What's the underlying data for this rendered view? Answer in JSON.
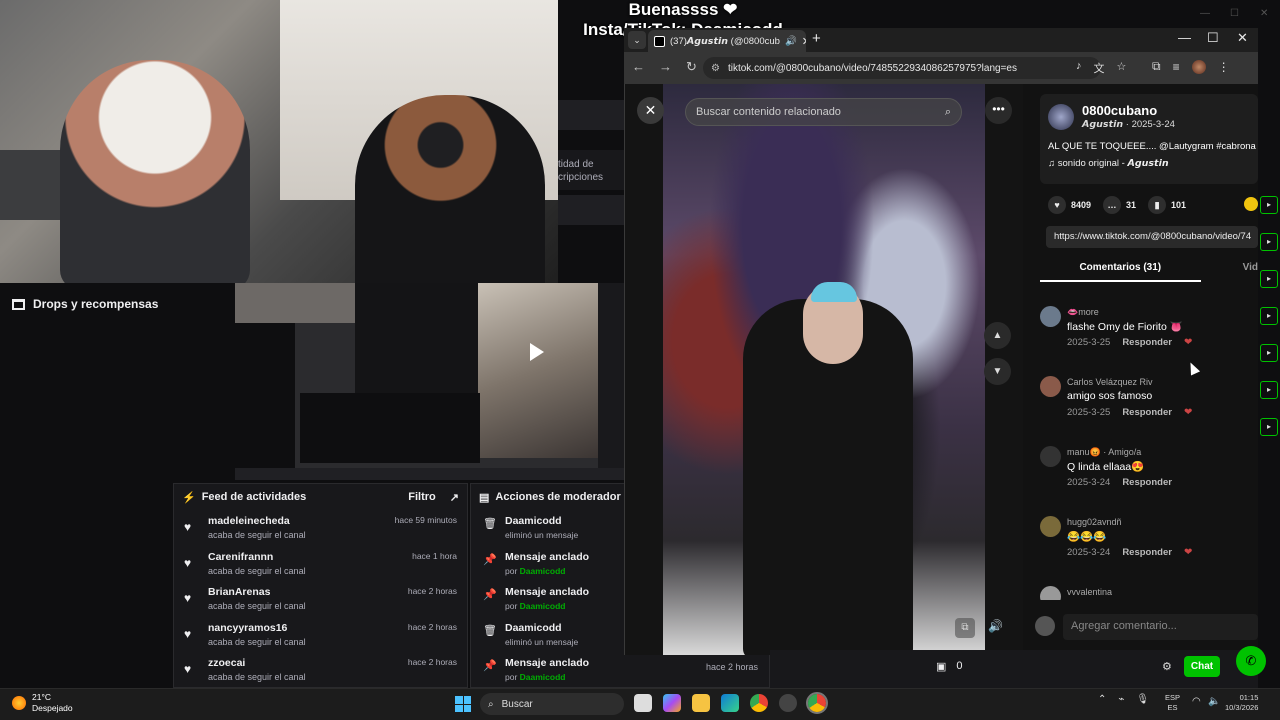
{
  "overlay": {
    "line1": "Buenassss ❤",
    "line2": "Insta/TikTok: Daamicodd"
  },
  "left_panel": {
    "drops_label": "Drops y recompensas"
  },
  "behind_panel": {
    "partial_text": "tidad de\ncripciones"
  },
  "feed": {
    "title": "Feed de actividades",
    "filter_label": "Filtro",
    "items": [
      {
        "name": "madeleinecheda",
        "sub": "acaba de seguir el canal",
        "time": "hace 59 minutos"
      },
      {
        "name": "Carenifrannn",
        "sub": "acaba de seguir el canal",
        "time": "hace 1 hora"
      },
      {
        "name": "BrianArenas",
        "sub": "acaba de seguir el canal",
        "time": "hace 2 horas"
      },
      {
        "name": "nancyyramos16",
        "sub": "acaba de seguir el canal",
        "time": "hace 2 horas"
      },
      {
        "name": "zzoecai",
        "sub": "acaba de seguir el canal",
        "time": "hace 2 horas"
      }
    ]
  },
  "moderator": {
    "title": "Acciones de moderador",
    "items": [
      {
        "icon": "trash-icon",
        "title": "Daamicodd",
        "sub": "eliminó un mensaje",
        "by": ""
      },
      {
        "icon": "pin-icon",
        "title": "Mensaje anclado",
        "sub": "por ",
        "by": "Daamicodd"
      },
      {
        "icon": "pin-icon",
        "title": "Mensaje anclado",
        "sub": "por ",
        "by": "Daamicodd"
      },
      {
        "icon": "trash-icon",
        "title": "Daamicodd",
        "sub": "eliminó un mensaje",
        "by": ""
      },
      {
        "icon": "pin-icon",
        "title": "Mensaje anclado",
        "sub": "por ",
        "by": "Daamicodd"
      }
    ],
    "last_time": "hace 2 horas"
  },
  "browser": {
    "tab_title": "(37)𝘼𝙜𝙪𝙨𝙩𝙞𝙣 (@0800cub",
    "url": "tiktok.com/@0800cubano/video/7485522934086257975?lang=es"
  },
  "video": {
    "search_placeholder": "Buscar contenido relacionado"
  },
  "post": {
    "author": "0800cubano",
    "display_name": "𝘼𝙜𝙪𝙨𝙩𝙞𝙣",
    "date": "· 2025-3-24",
    "caption": "AL QUE TE TOQUEEE.... @Lautygram #cabrona #l",
    "music_label": "sonido original - ",
    "music_author": "𝘼𝙜𝙪𝙨𝙩𝙞𝙣",
    "likes": "8409",
    "comments": "31",
    "saves": "101",
    "share_url": "https://www.tiktok.com/@0800cubano/video/74",
    "tab_comments": "Comentarios (31)",
    "tab_other": "Vid"
  },
  "comments": [
    {
      "user": "👄more",
      "text": "flashe Omy de Fiorito 👅",
      "date": "2025-3-25",
      "reply": "Responder"
    },
    {
      "user": "Carlos Velázquez Riv",
      "text": "amigo sos famoso",
      "date": "2025-3-25",
      "reply": "Responder"
    },
    {
      "user": "manu😡 · Amigo/a",
      "text": "Q linda ellaaa😍",
      "date": "2025-3-24",
      "reply": "Responder"
    },
    {
      "user": "hugg02avndñ",
      "text": "😂😂😂",
      "date": "2025-3-24",
      "reply": "Responder"
    },
    {
      "user": "vvvalentina",
      "text": "",
      "date": "",
      "reply": ""
    }
  ],
  "add_comment_placeholder": "Agregar comentario...",
  "chatbar": {
    "time": "hace 2 horas",
    "points": "0",
    "chat_label": "Chat"
  },
  "taskbar": {
    "weather_temp": "21°C",
    "weather_desc": "Despejado",
    "search_label": "Buscar",
    "lang1": "ESP",
    "lang2": "ES",
    "time": "01:15",
    "date": "10/3/2026"
  },
  "colors": {
    "twitch_green": "#00c200",
    "accent_blue": "#4cc2ff"
  }
}
